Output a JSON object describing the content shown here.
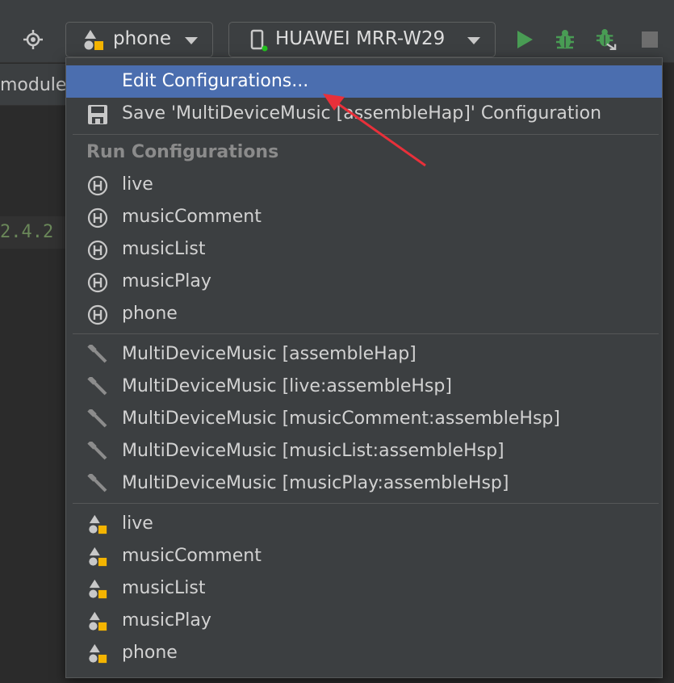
{
  "toolbar": {
    "config_selector": {
      "label": "phone",
      "icon": "module-config-icon"
    },
    "device_selector": {
      "label": "HUAWEI MRR-W29",
      "icon": "phone-device-icon",
      "status_color": "#23c11f"
    },
    "buttons": [
      {
        "name": "run",
        "icon": "play-icon",
        "color": "#499c54"
      },
      {
        "name": "debug",
        "icon": "bug-icon",
        "color": "#499c54"
      },
      {
        "name": "attach-debugger",
        "icon": "bug-attach-icon",
        "color": "#499c54"
      },
      {
        "name": "stop",
        "icon": "stop-icon",
        "color": "#6e6e6e"
      }
    ]
  },
  "editor": {
    "tab_label": "module",
    "code_snippet": "2.4.2"
  },
  "popup": {
    "edit_item": {
      "label": "Edit Configurations..."
    },
    "save_item": {
      "label": "Save 'MultiDeviceMusic [assembleHap]' Configuration",
      "icon": "save-icon"
    },
    "run_configs_header": "Run Configurations",
    "harmony_items": [
      {
        "label": "live"
      },
      {
        "label": "musicComment"
      },
      {
        "label": "musicList"
      },
      {
        "label": "musicPlay"
      },
      {
        "label": "phone"
      }
    ],
    "build_items": [
      {
        "label": "MultiDeviceMusic [assembleHap]"
      },
      {
        "label": "MultiDeviceMusic [live:assembleHsp]"
      },
      {
        "label": "MultiDeviceMusic [musicComment:assembleHsp]"
      },
      {
        "label": "MultiDeviceMusic [musicList:assembleHsp]"
      },
      {
        "label": "MultiDeviceMusic [musicPlay:assembleHsp]"
      }
    ],
    "module_items": [
      {
        "label": "live"
      },
      {
        "label": "musicComment"
      },
      {
        "label": "musicList"
      },
      {
        "label": "musicPlay"
      },
      {
        "label": "phone"
      }
    ]
  },
  "colors": {
    "selection": "#4b6eaf",
    "annotation_arrow": "#e8303a",
    "shape_gray": "#c8c8c8",
    "shape_yellow": "#f4b400"
  }
}
